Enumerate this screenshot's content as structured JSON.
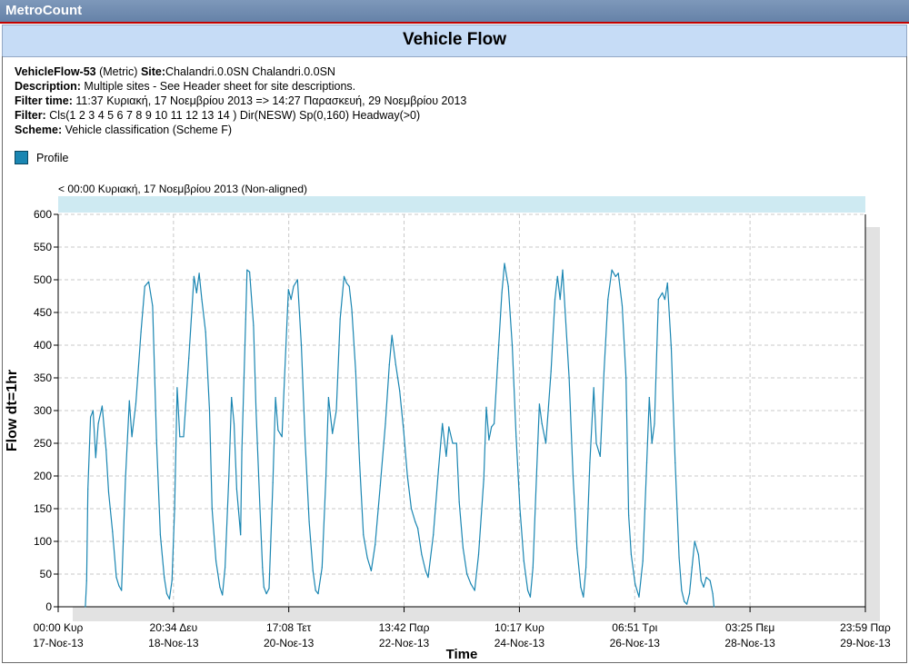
{
  "app": {
    "title": "MetroCount"
  },
  "report": {
    "title": "Vehicle Flow"
  },
  "info": {
    "line1": {
      "name": "VehicleFlow-53",
      "units": " (Metric) ",
      "site_label": "Site:",
      "site_value": "Chalandri.0.0SN Chalandri.0.0SN"
    },
    "line2": {
      "label": "Description:",
      "value": " Multiple sites - See Header sheet for site descriptions."
    },
    "line3": {
      "label": "Filter time:",
      "value": " 11:37 Κυριακή, 17 Νοεμβρίου 2013 => 14:27 Παρασκευή, 29 Νοεμβρίου 2013"
    },
    "line4": {
      "label": "Filter:",
      "value": " Cls(1 2 3 4 5 6 7 8 9 10 11 12 13 14 ) Dir(NESW) Sp(0,160) Headway(>0)"
    },
    "line5": {
      "label": "Scheme:",
      "value": " Vehicle classification (Scheme F)"
    }
  },
  "legend": {
    "label": "Profile",
    "color": "#1a86b2"
  },
  "chart_note": "< 00:00 Κυριακή, 17 Νοεμβρίου 2013 (Non-aligned)",
  "chart_data": {
    "type": "line",
    "title": "Vehicle Flow",
    "xlabel": "Time",
    "ylabel": "Flow dt=1hr",
    "ylim": [
      0,
      600
    ],
    "yticks": [
      0,
      50,
      100,
      150,
      200,
      250,
      300,
      350,
      400,
      450,
      500,
      550,
      600
    ],
    "xlim_hours": [
      0,
      312
    ],
    "x_unit": "hours since 00:00 Κυρ 17-Νοε-13",
    "xtick_hours": [
      0,
      44.57,
      89.13,
      133.7,
      178.28,
      222.85,
      267.42,
      312
    ],
    "xtick_labels": [
      [
        "00:00 Κυρ",
        "17-Νοε-13"
      ],
      [
        "20:34 Δευ",
        "18-Νοε-13"
      ],
      [
        "17:08 Τετ",
        "20-Νοε-13"
      ],
      [
        "13:42 Παρ",
        "22-Νοε-13"
      ],
      [
        "10:17 Κυρ",
        "24-Νοε-13"
      ],
      [
        "06:51 Τρι",
        "26-Νοε-13"
      ],
      [
        "03:25 Πεμ",
        "28-Νοε-13"
      ],
      [
        "23:59 Παρ",
        "29-Νοε-13"
      ]
    ],
    "grid": true,
    "series": [
      {
        "name": "Profile",
        "color": "#1a86b2",
        "points": [
          [
            10.5,
            0
          ],
          [
            11,
            40
          ],
          [
            11.5,
            180
          ],
          [
            12.5,
            290
          ],
          [
            13.5,
            300
          ],
          [
            14.5,
            228
          ],
          [
            15.5,
            280
          ],
          [
            17,
            307
          ],
          [
            18.5,
            240
          ],
          [
            19.5,
            175
          ],
          [
            21,
            115
          ],
          [
            22.5,
            45
          ],
          [
            23.5,
            32
          ],
          [
            24.5,
            25
          ],
          [
            26,
            195
          ],
          [
            27.5,
            315
          ],
          [
            28.5,
            260
          ],
          [
            30,
            310
          ],
          [
            32,
            420
          ],
          [
            33.5,
            490
          ],
          [
            35,
            497
          ],
          [
            36.5,
            460
          ],
          [
            38,
            255
          ],
          [
            39.5,
            110
          ],
          [
            41,
            45
          ],
          [
            42,
            20
          ],
          [
            43,
            12
          ],
          [
            44,
            40
          ],
          [
            45,
            150
          ],
          [
            46,
            335
          ],
          [
            47,
            260
          ],
          [
            48.5,
            260
          ],
          [
            50.5,
            380
          ],
          [
            52.5,
            505
          ],
          [
            53.5,
            480
          ],
          [
            54.5,
            510
          ],
          [
            55.5,
            470
          ],
          [
            57,
            420
          ],
          [
            58.5,
            300
          ],
          [
            59.5,
            150
          ],
          [
            61,
            70
          ],
          [
            62.5,
            30
          ],
          [
            63.5,
            18
          ],
          [
            64.5,
            60
          ],
          [
            66,
            200
          ],
          [
            67,
            320
          ],
          [
            68,
            280
          ],
          [
            69,
            180
          ],
          [
            70.5,
            110
          ],
          [
            71,
            240
          ],
          [
            72.5,
            440
          ],
          [
            73,
            515
          ],
          [
            74,
            512
          ],
          [
            75.5,
            430
          ],
          [
            76.5,
            300
          ],
          [
            78,
            150
          ],
          [
            79,
            60
          ],
          [
            79.5,
            30
          ],
          [
            80.5,
            20
          ],
          [
            81.5,
            28
          ],
          [
            83,
            190
          ],
          [
            84,
            320
          ],
          [
            85,
            270
          ],
          [
            86.5,
            260
          ],
          [
            87.5,
            350
          ],
          [
            89,
            485
          ],
          [
            90,
            470
          ],
          [
            91,
            490
          ],
          [
            92.5,
            500
          ],
          [
            94,
            400
          ],
          [
            95.5,
            250
          ],
          [
            97,
            130
          ],
          [
            98.5,
            55
          ],
          [
            99.5,
            25
          ],
          [
            100.5,
            20
          ],
          [
            102,
            60
          ],
          [
            103.5,
            200
          ],
          [
            104.5,
            320
          ],
          [
            106,
            265
          ],
          [
            107.5,
            300
          ],
          [
            109,
            440
          ],
          [
            110.5,
            505
          ],
          [
            111.5,
            495
          ],
          [
            112.5,
            490
          ],
          [
            113.5,
            455
          ],
          [
            115,
            360
          ],
          [
            116.5,
            220
          ],
          [
            118,
            110
          ],
          [
            119.5,
            75
          ],
          [
            121,
            55
          ],
          [
            122.5,
            95
          ],
          [
            124.5,
            185
          ],
          [
            126.5,
            280
          ],
          [
            128,
            370
          ],
          [
            129,
            415
          ],
          [
            130.5,
            370
          ],
          [
            132,
            330
          ],
          [
            133.5,
            270
          ],
          [
            135,
            200
          ],
          [
            136.5,
            150
          ],
          [
            138,
            130
          ],
          [
            139,
            120
          ],
          [
            140.5,
            80
          ],
          [
            142,
            55
          ],
          [
            143,
            45
          ],
          [
            145,
            110
          ],
          [
            147,
            210
          ],
          [
            148.5,
            280
          ],
          [
            150,
            230
          ],
          [
            151,
            275
          ],
          [
            152.5,
            250
          ],
          [
            154,
            250
          ],
          [
            155,
            160
          ],
          [
            156.5,
            90
          ],
          [
            158,
            50
          ],
          [
            159.5,
            35
          ],
          [
            161,
            25
          ],
          [
            162.5,
            80
          ],
          [
            164.5,
            195
          ],
          [
            165.5,
            305
          ],
          [
            166.5,
            255
          ],
          [
            167.5,
            275
          ],
          [
            168.5,
            280
          ],
          [
            170,
            380
          ],
          [
            171.5,
            480
          ],
          [
            172.5,
            525
          ],
          [
            174,
            490
          ],
          [
            175.5,
            400
          ],
          [
            177,
            260
          ],
          [
            178.5,
            150
          ],
          [
            180,
            70
          ],
          [
            181.5,
            25
          ],
          [
            182.5,
            15
          ],
          [
            183.5,
            60
          ],
          [
            185,
            210
          ],
          [
            186,
            310
          ],
          [
            187,
            280
          ],
          [
            188.5,
            250
          ],
          [
            190.5,
            360
          ],
          [
            192,
            470
          ],
          [
            193,
            505
          ],
          [
            194,
            470
          ],
          [
            195,
            515
          ],
          [
            196,
            450
          ],
          [
            197.5,
            350
          ],
          [
            199,
            200
          ],
          [
            200.5,
            90
          ],
          [
            202,
            30
          ],
          [
            203,
            15
          ],
          [
            204,
            60
          ],
          [
            205.5,
            220
          ],
          [
            207,
            335
          ],
          [
            208,
            250
          ],
          [
            209.5,
            230
          ],
          [
            211,
            360
          ],
          [
            212.5,
            470
          ],
          [
            214,
            515
          ],
          [
            215.5,
            505
          ],
          [
            216.5,
            510
          ],
          [
            218,
            460
          ],
          [
            219.5,
            350
          ],
          [
            220.5,
            140
          ],
          [
            221.5,
            80
          ],
          [
            223,
            35
          ],
          [
            224.5,
            15
          ],
          [
            226,
            70
          ],
          [
            227.5,
            220
          ],
          [
            228.5,
            320
          ],
          [
            229.5,
            250
          ],
          [
            230.5,
            280
          ],
          [
            232,
            470
          ],
          [
            233.5,
            480
          ],
          [
            234.5,
            470
          ],
          [
            235.5,
            495
          ],
          [
            237,
            395
          ],
          [
            238.5,
            220
          ],
          [
            240,
            75
          ],
          [
            241,
            25
          ],
          [
            242,
            8
          ],
          [
            243,
            4
          ],
          [
            244,
            20
          ],
          [
            245,
            60
          ],
          [
            246,
            100
          ],
          [
            247.5,
            80
          ],
          [
            248.5,
            40
          ],
          [
            249.5,
            30
          ],
          [
            250.5,
            45
          ],
          [
            252,
            40
          ],
          [
            253,
            20
          ],
          [
            253.5,
            0
          ]
        ]
      }
    ]
  }
}
